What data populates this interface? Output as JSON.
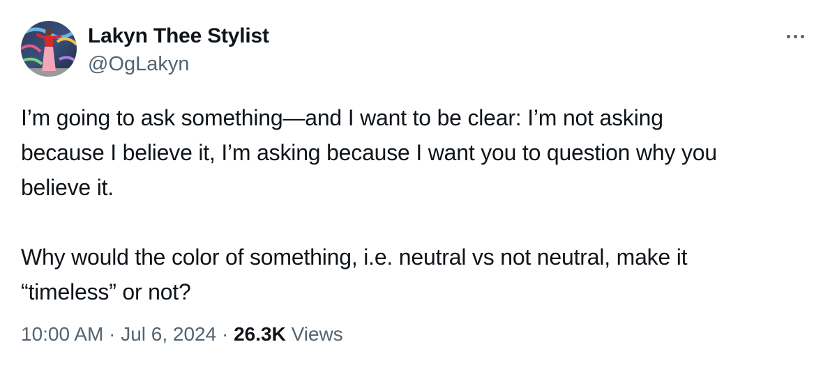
{
  "author": {
    "display_name": "Lakyn Thee Stylist",
    "handle": "@OgLakyn",
    "avatar_icon": "profile-photo"
  },
  "more_icon": "ellipsis-horizontal-icon",
  "tweet": {
    "paragraph_1": "I’m going to ask something—and I want to be clear: I’m not asking\nbecause I believe it, I’m asking because I want you to question why you\nbelieve it.",
    "paragraph_2": "Why would the color of something, i.e. neutral vs not neutral, make it\n“timeless” or not?"
  },
  "meta": {
    "time": "10:00 AM",
    "separator": " · ",
    "date": "Jul 6, 2024",
    "views_count": "26.3K",
    "views_label": "Views"
  },
  "colors": {
    "text_primary": "#0f1419",
    "text_secondary": "#536471",
    "background": "#ffffff"
  }
}
